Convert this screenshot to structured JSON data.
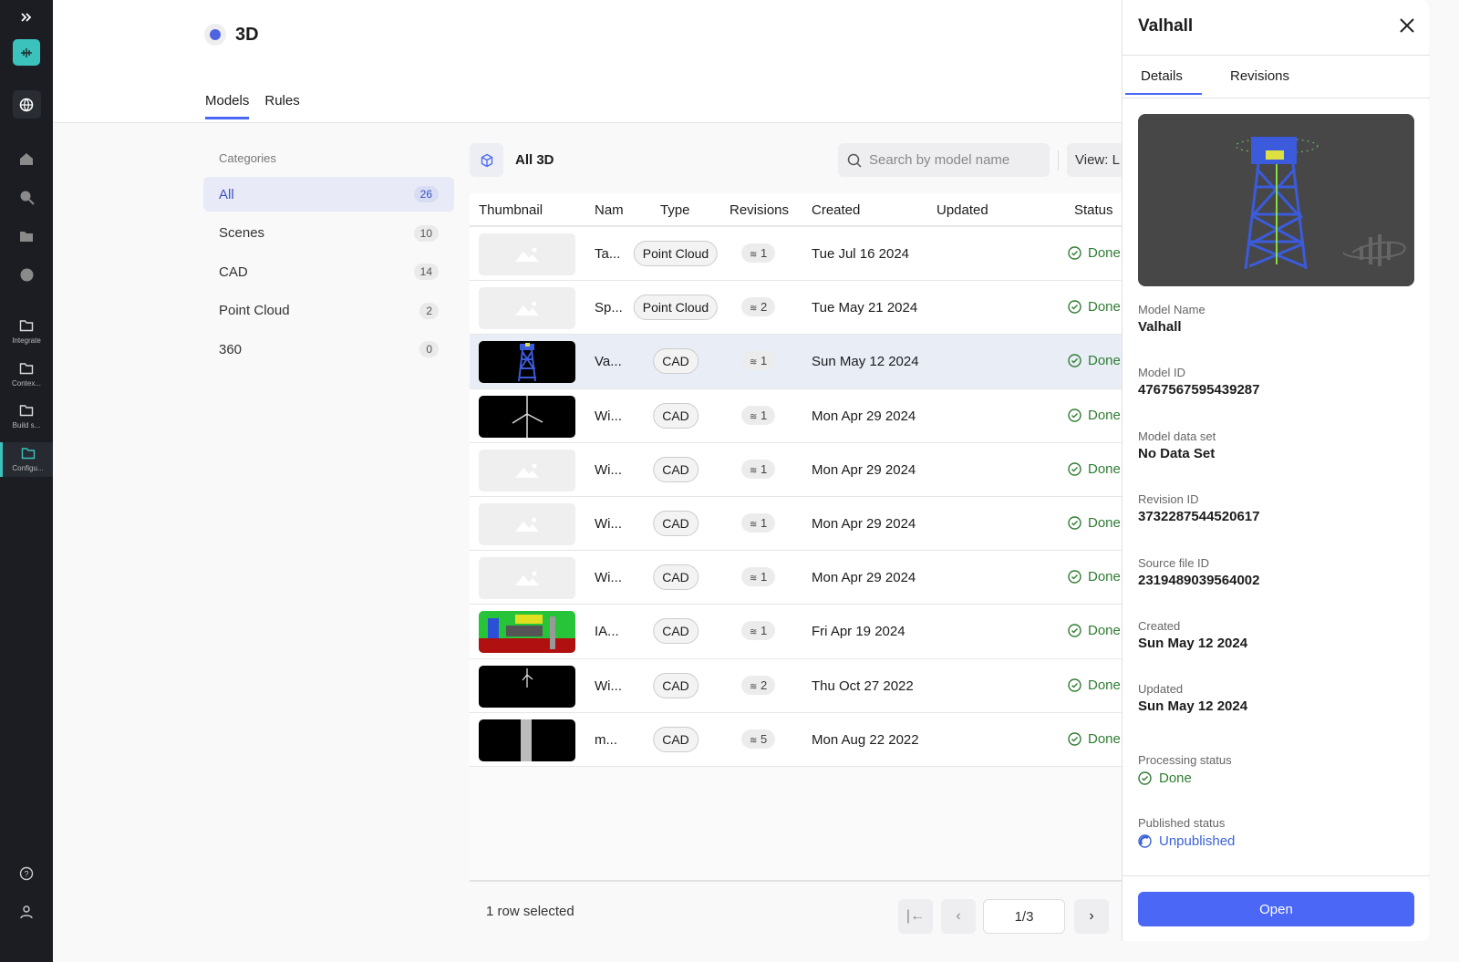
{
  "sidebar": {
    "items": [
      {
        "label": "Integrate"
      },
      {
        "label": "Contex..."
      },
      {
        "label": "Build s..."
      },
      {
        "label": "Configu..."
      }
    ]
  },
  "header": {
    "title": "3D",
    "tabs": [
      {
        "label": "Models"
      },
      {
        "label": "Rules"
      }
    ]
  },
  "categories": {
    "heading": "Categories",
    "items": [
      {
        "label": "All",
        "count": "26"
      },
      {
        "label": "Scenes",
        "count": "10"
      },
      {
        "label": "CAD",
        "count": "14"
      },
      {
        "label": "Point Cloud",
        "count": "2"
      },
      {
        "label": "360",
        "count": "0"
      }
    ]
  },
  "toolbar": {
    "title": "All 3D",
    "search_placeholder": "Search by model name",
    "view_label": "View: L"
  },
  "table": {
    "columns": [
      "Thumbnail",
      "Nam",
      "Type",
      "Revisions",
      "Created",
      "Updated",
      "Status"
    ],
    "rows": [
      {
        "thumb": "placeholder",
        "name": "Ta...",
        "type": "Point Cloud",
        "revisions": "1",
        "created": "Tue Jul 16 2024",
        "updated": "",
        "status": "Done"
      },
      {
        "thumb": "placeholder",
        "name": "Sp...",
        "type": "Point Cloud",
        "revisions": "2",
        "created": "Tue May 21 2024",
        "updated": "",
        "status": "Done"
      },
      {
        "thumb": "tower",
        "name": "Va...",
        "type": "CAD",
        "revisions": "1",
        "created": "Sun May 12 2024",
        "updated": "",
        "status": "Done",
        "selected": true
      },
      {
        "thumb": "turbine",
        "name": "Wi...",
        "type": "CAD",
        "revisions": "1",
        "created": "Mon Apr 29 2024",
        "updated": "",
        "status": "Done"
      },
      {
        "thumb": "placeholder",
        "name": "Wi...",
        "type": "CAD",
        "revisions": "1",
        "created": "Mon Apr 29 2024",
        "updated": "",
        "status": "Done"
      },
      {
        "thumb": "placeholder",
        "name": "Wi...",
        "type": "CAD",
        "revisions": "1",
        "created": "Mon Apr 29 2024",
        "updated": "",
        "status": "Done"
      },
      {
        "thumb": "placeholder",
        "name": "Wi...",
        "type": "CAD",
        "revisions": "1",
        "created": "Mon Apr 29 2024",
        "updated": "",
        "status": "Done"
      },
      {
        "thumb": "plant",
        "name": "IA...",
        "type": "CAD",
        "revisions": "1",
        "created": "Fri Apr 19 2024",
        "updated": "",
        "status": "Done"
      },
      {
        "thumb": "turbine-small",
        "name": "Wi...",
        "type": "CAD",
        "revisions": "2",
        "created": "Thu Oct 27 2022",
        "updated": "",
        "status": "Done"
      },
      {
        "thumb": "pipe",
        "name": "m...",
        "type": "CAD",
        "revisions": "5",
        "created": "Mon Aug 22 2022",
        "updated": "",
        "status": "Done"
      }
    ]
  },
  "footer": {
    "selection": "1 row selected",
    "page": "1/3"
  },
  "panel": {
    "title": "Valhall",
    "tabs": [
      {
        "label": "Details"
      },
      {
        "label": "Revisions"
      }
    ],
    "fields": [
      {
        "label": "Model Name",
        "value": "Valhall"
      },
      {
        "label": "Model ID",
        "value": "4767567595439287"
      },
      {
        "label": "Model data set",
        "value": "No Data Set"
      },
      {
        "label": "Revision ID",
        "value": "3732287544520617"
      },
      {
        "label": "Source file ID",
        "value": "2319489039564002"
      },
      {
        "label": "Created",
        "value": "Sun May 12 2024"
      },
      {
        "label": "Updated",
        "value": "Sun May 12 2024"
      }
    ],
    "processing_label": "Processing status",
    "processing_value": "Done",
    "published_label": "Published status",
    "published_value": "Unpublished",
    "open_label": "Open"
  },
  "colors": {
    "accent": "#4a67f5",
    "done": "#2f7d32",
    "unpublished": "#3a62d8",
    "sidebar": "#1b1d23",
    "brand": "#3cc2bd"
  }
}
